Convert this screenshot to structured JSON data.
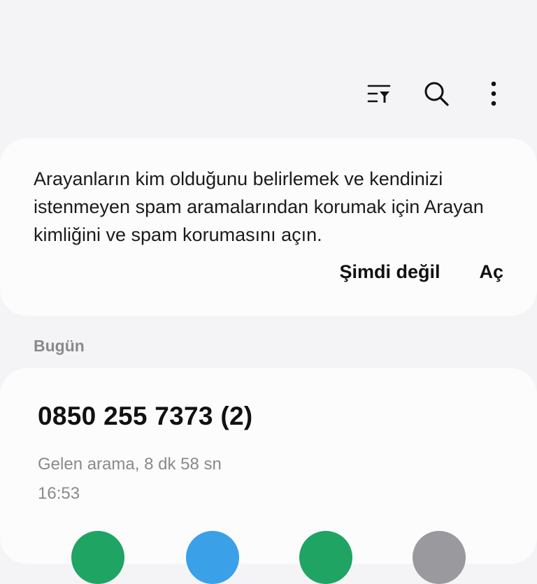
{
  "toolbar": {
    "icons": [
      "filter-icon",
      "search-icon",
      "more-options-icon"
    ]
  },
  "banner": {
    "message": "Arayanların kim olduğunu belirlemek ve kendinizi istenmeyen spam aramalarından korumak için Arayan kimliğini ve spam korumasını açın.",
    "dismiss_label": "Şimdi değil",
    "enable_label": "Aç"
  },
  "section": {
    "today_label": "Bugün"
  },
  "call": {
    "number": "0850 255 7373 (2)",
    "detail": "Gelen arama, 8 dk 58 sn",
    "time": "16:53",
    "action_colors": [
      "#1fa463",
      "#3aa0e8",
      "#1fa463",
      "#9a9a9e"
    ]
  }
}
